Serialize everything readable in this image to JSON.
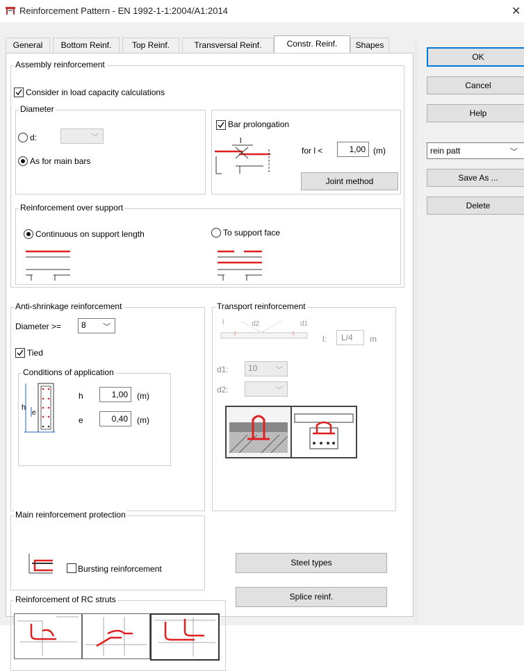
{
  "window": {
    "title": "Reinforcement Pattern - EN 1992-1-1:2004/A1:2014",
    "close": "✕"
  },
  "tabs": [
    "General",
    "Bottom Reinf.",
    "Top Reinf.",
    "Transversal Reinf.",
    "Constr. Reinf.",
    "Shapes"
  ],
  "active_tab": "Constr. Reinf.",
  "right_panel": {
    "ok": "OK",
    "cancel": "Cancel",
    "help": "Help",
    "pattern_select": "rein patt",
    "save_as": "Save As ...",
    "delete": "Delete"
  },
  "assembly": {
    "title": "Assembly reinforcement",
    "consider_label": "Consider in load capacity calculations",
    "consider_checked": true,
    "diameter": {
      "title": "Diameter",
      "d_label": "d:",
      "d_value": "",
      "as_main_label": "As for main bars",
      "selected": "as_main"
    },
    "prolongation": {
      "label": "Bar prolongation",
      "checked": true,
      "l_symbol": "l",
      "for_label": "for l <",
      "value": "1,00",
      "unit": "(m)",
      "joint_button": "Joint method"
    },
    "support": {
      "title": "Reinforcement over support",
      "continuous_label": "Continuous on support length",
      "face_label": "To support face",
      "selected": "continuous"
    }
  },
  "anti_shrinkage": {
    "title": "Anti-shrinkage reinforcement",
    "diameter_label": "Diameter >=",
    "diameter_value": "8",
    "tied_label": "Tied",
    "tied_checked": true,
    "conditions": {
      "title": "Conditions of application",
      "h_label": "h",
      "h_value": "1,00",
      "h_unit": "(m)",
      "e_label": "e",
      "e_value": "0,40",
      "e_unit": "(m)",
      "fig_h": "h",
      "fig_e": "e"
    }
  },
  "transport": {
    "title": "Transport reinforcement",
    "fig_l": "l",
    "fig_d2": "d2",
    "fig_d1": "d1",
    "l_label": "l:",
    "l_value": "L/4",
    "l_unit": "m",
    "d1_label": "d1:",
    "d1_value": "10",
    "d2_label": "d2:",
    "d2_value": ""
  },
  "main_protection": {
    "title": "Main reinforcement protection",
    "bursting_label": "Bursting reinforcement",
    "bursting_checked": false
  },
  "steel_types": "Steel types",
  "splice": "Splice reinf.",
  "struts": {
    "title": "Reinforcement of RC struts"
  },
  "colors": {
    "accent": "#0078d7",
    "rebar": "#e02020"
  }
}
